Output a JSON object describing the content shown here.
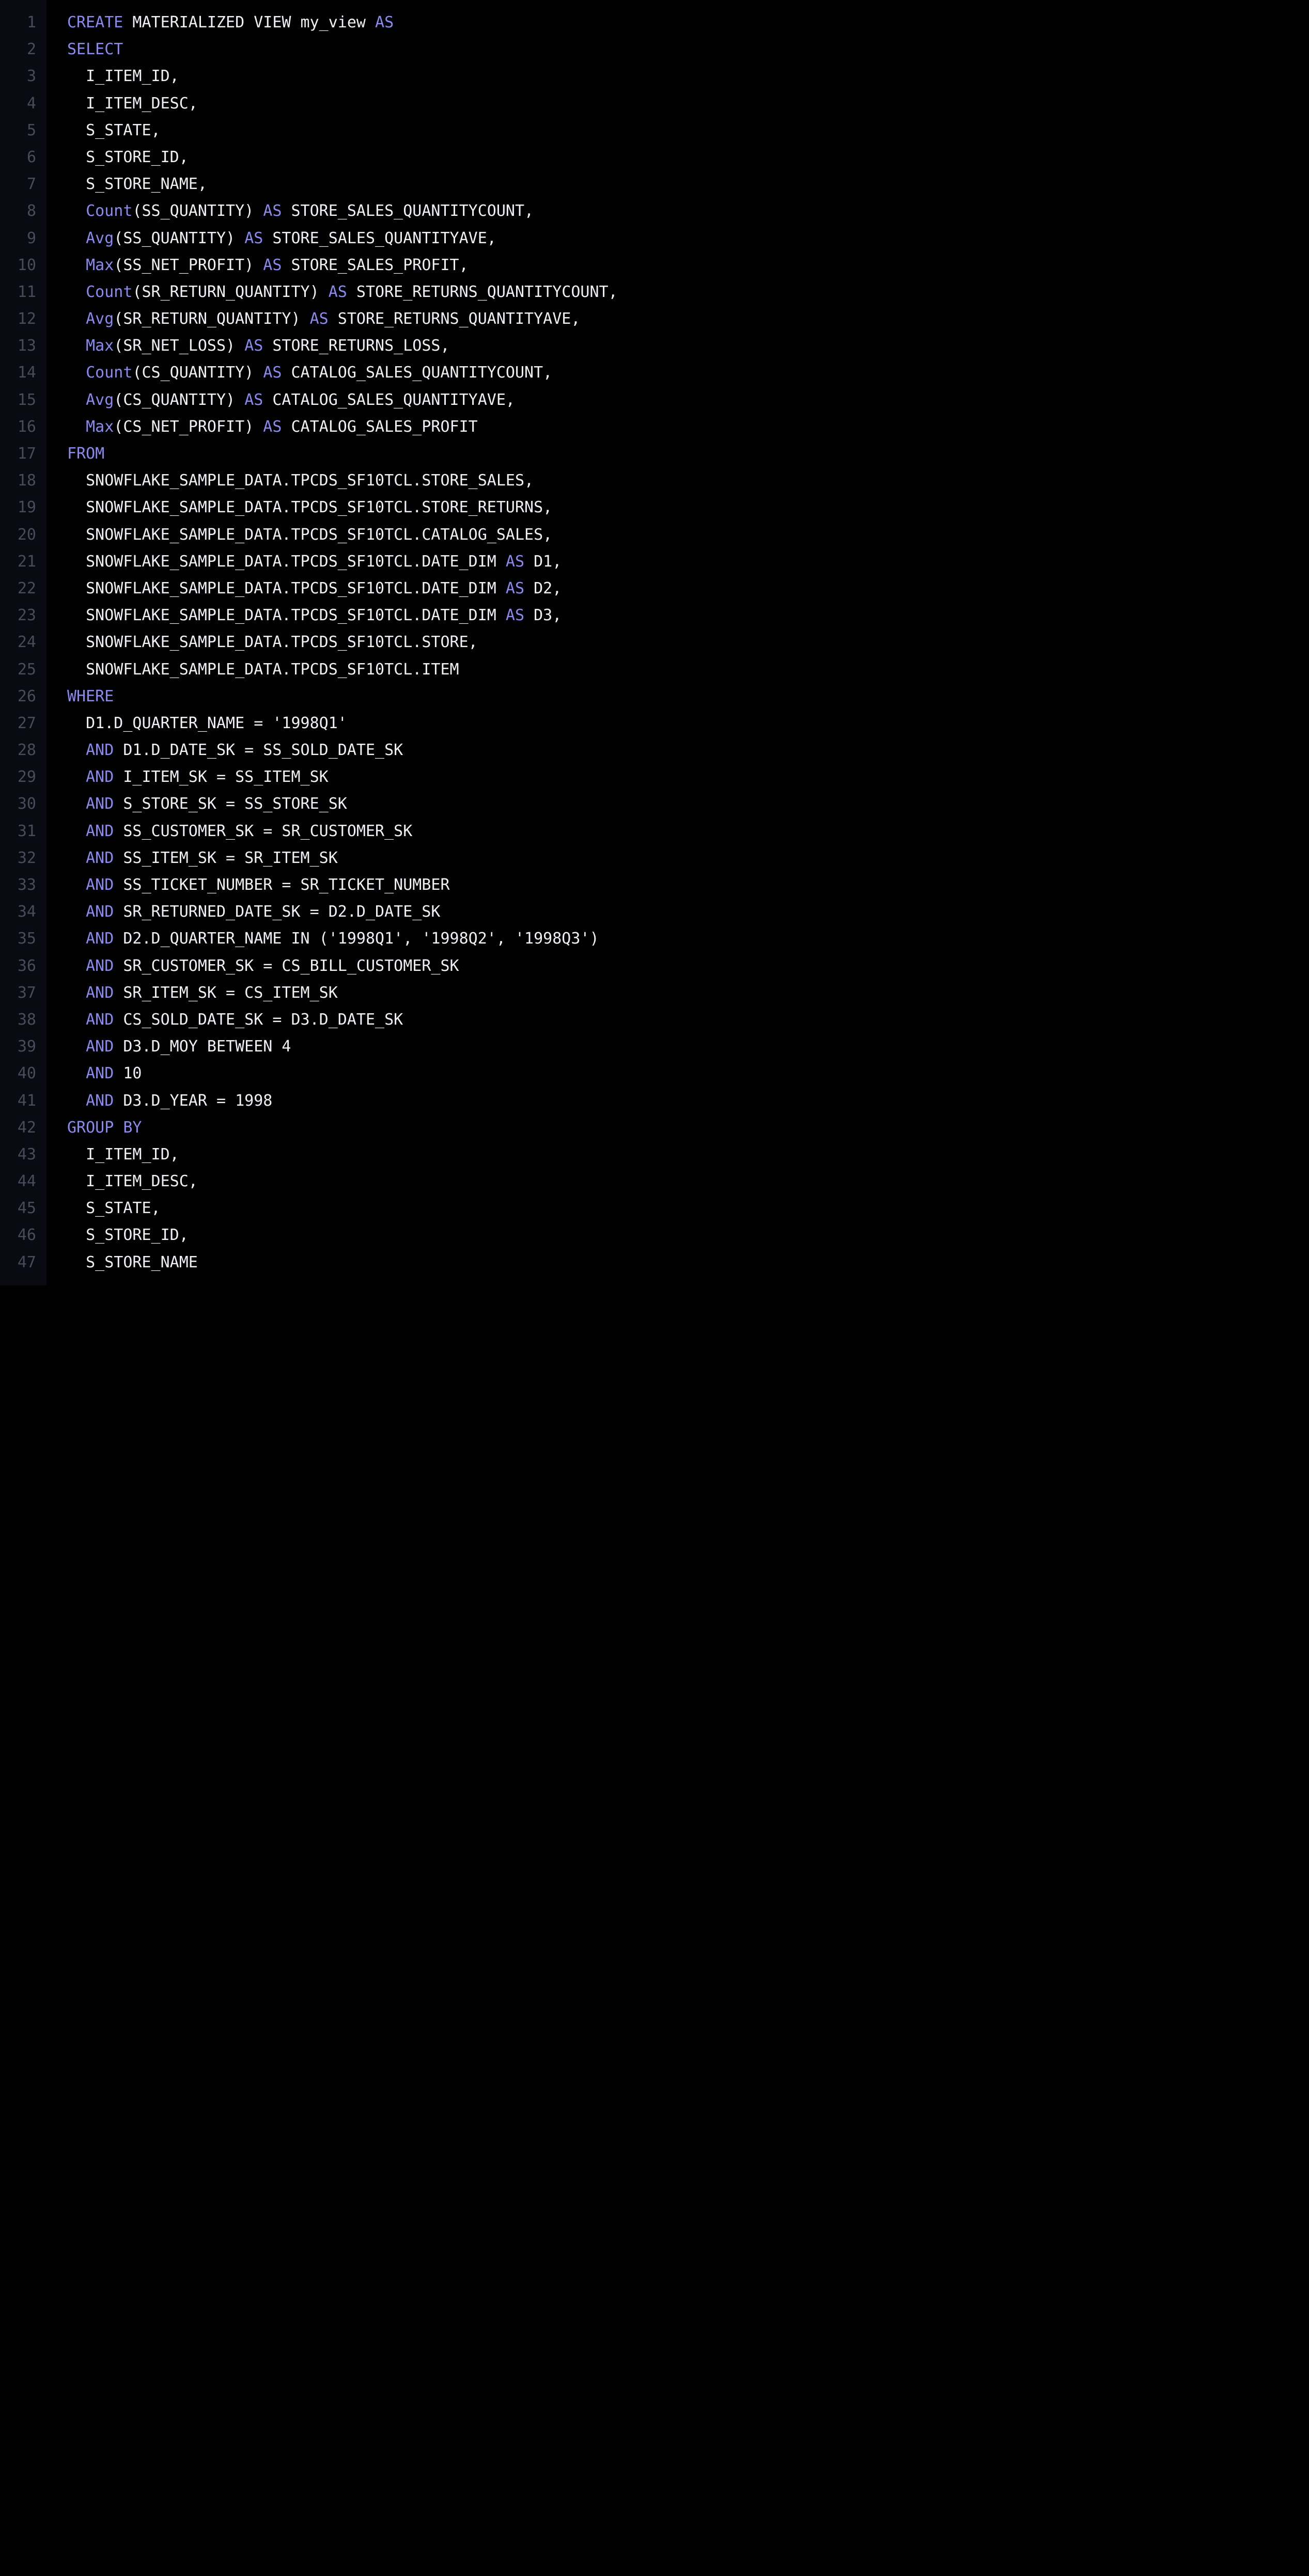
{
  "lines": [
    {
      "n": "1",
      "tokens": [
        {
          "t": "CREATE",
          "c": "kw"
        },
        {
          "t": " MATERIALIZED VIEW my_view ",
          "c": "txt"
        },
        {
          "t": "AS",
          "c": "kw"
        }
      ]
    },
    {
      "n": "2",
      "tokens": [
        {
          "t": "SELECT",
          "c": "kw"
        }
      ]
    },
    {
      "n": "3",
      "tokens": [
        {
          "t": "  I_ITEM_ID,",
          "c": "txt"
        }
      ]
    },
    {
      "n": "4",
      "tokens": [
        {
          "t": "  I_ITEM_DESC,",
          "c": "txt"
        }
      ]
    },
    {
      "n": "5",
      "tokens": [
        {
          "t": "  S_STATE,",
          "c": "txt"
        }
      ]
    },
    {
      "n": "6",
      "tokens": [
        {
          "t": "  S_STORE_ID,",
          "c": "txt"
        }
      ]
    },
    {
      "n": "7",
      "tokens": [
        {
          "t": "  S_STORE_NAME,",
          "c": "txt"
        }
      ]
    },
    {
      "n": "8",
      "tokens": [
        {
          "t": "  ",
          "c": "txt"
        },
        {
          "t": "Count",
          "c": "fn"
        },
        {
          "t": "(SS_QUANTITY) ",
          "c": "txt"
        },
        {
          "t": "AS",
          "c": "kw"
        },
        {
          "t": " STORE_SALES_QUANTITYCOUNT,",
          "c": "txt"
        }
      ]
    },
    {
      "n": "9",
      "tokens": [
        {
          "t": "  ",
          "c": "txt"
        },
        {
          "t": "Avg",
          "c": "fn"
        },
        {
          "t": "(SS_QUANTITY) ",
          "c": "txt"
        },
        {
          "t": "AS",
          "c": "kw"
        },
        {
          "t": " STORE_SALES_QUANTITYAVE,",
          "c": "txt"
        }
      ]
    },
    {
      "n": "10",
      "tokens": [
        {
          "t": "  ",
          "c": "txt"
        },
        {
          "t": "Max",
          "c": "fn"
        },
        {
          "t": "(SS_NET_PROFIT) ",
          "c": "txt"
        },
        {
          "t": "AS",
          "c": "kw"
        },
        {
          "t": " STORE_SALES_PROFIT,",
          "c": "txt"
        }
      ]
    },
    {
      "n": "11",
      "tokens": [
        {
          "t": "  ",
          "c": "txt"
        },
        {
          "t": "Count",
          "c": "fn"
        },
        {
          "t": "(SR_RETURN_QUANTITY) ",
          "c": "txt"
        },
        {
          "t": "AS",
          "c": "kw"
        },
        {
          "t": " STORE_RETURNS_QUANTITYCOUNT,",
          "c": "txt"
        }
      ]
    },
    {
      "n": "12",
      "tokens": [
        {
          "t": "  ",
          "c": "txt"
        },
        {
          "t": "Avg",
          "c": "fn"
        },
        {
          "t": "(SR_RETURN_QUANTITY) ",
          "c": "txt"
        },
        {
          "t": "AS",
          "c": "kw"
        },
        {
          "t": " STORE_RETURNS_QUANTITYAVE,",
          "c": "txt"
        }
      ]
    },
    {
      "n": "13",
      "tokens": [
        {
          "t": "  ",
          "c": "txt"
        },
        {
          "t": "Max",
          "c": "fn"
        },
        {
          "t": "(SR_NET_LOSS) ",
          "c": "txt"
        },
        {
          "t": "AS",
          "c": "kw"
        },
        {
          "t": " STORE_RETURNS_LOSS,",
          "c": "txt"
        }
      ]
    },
    {
      "n": "14",
      "tokens": [
        {
          "t": "  ",
          "c": "txt"
        },
        {
          "t": "Count",
          "c": "fn"
        },
        {
          "t": "(CS_QUANTITY) ",
          "c": "txt"
        },
        {
          "t": "AS",
          "c": "kw"
        },
        {
          "t": " CATALOG_SALES_QUANTITYCOUNT,",
          "c": "txt"
        }
      ]
    },
    {
      "n": "15",
      "tokens": [
        {
          "t": "  ",
          "c": "txt"
        },
        {
          "t": "Avg",
          "c": "fn"
        },
        {
          "t": "(CS_QUANTITY) ",
          "c": "txt"
        },
        {
          "t": "AS",
          "c": "kw"
        },
        {
          "t": " CATALOG_SALES_QUANTITYAVE,",
          "c": "txt"
        }
      ]
    },
    {
      "n": "16",
      "tokens": [
        {
          "t": "  ",
          "c": "txt"
        },
        {
          "t": "Max",
          "c": "fn"
        },
        {
          "t": "(CS_NET_PROFIT) ",
          "c": "txt"
        },
        {
          "t": "AS",
          "c": "kw"
        },
        {
          "t": " CATALOG_SALES_PROFIT",
          "c": "txt"
        }
      ]
    },
    {
      "n": "17",
      "tokens": [
        {
          "t": "FROM",
          "c": "kw"
        }
      ]
    },
    {
      "n": "18",
      "tokens": [
        {
          "t": "  SNOWFLAKE_SAMPLE_DATA.TPCDS_SF10TCL.STORE_SALES,",
          "c": "txt"
        }
      ]
    },
    {
      "n": "19",
      "tokens": [
        {
          "t": "  SNOWFLAKE_SAMPLE_DATA.TPCDS_SF10TCL.STORE_RETURNS,",
          "c": "txt"
        }
      ]
    },
    {
      "n": "20",
      "tokens": [
        {
          "t": "  SNOWFLAKE_SAMPLE_DATA.TPCDS_SF10TCL.CATALOG_SALES,",
          "c": "txt"
        }
      ]
    },
    {
      "n": "21",
      "tokens": [
        {
          "t": "  SNOWFLAKE_SAMPLE_DATA.TPCDS_SF10TCL.DATE_DIM ",
          "c": "txt"
        },
        {
          "t": "AS",
          "c": "kw"
        },
        {
          "t": " D1,",
          "c": "txt"
        }
      ]
    },
    {
      "n": "22",
      "tokens": [
        {
          "t": "  SNOWFLAKE_SAMPLE_DATA.TPCDS_SF10TCL.DATE_DIM ",
          "c": "txt"
        },
        {
          "t": "AS",
          "c": "kw"
        },
        {
          "t": " D2,",
          "c": "txt"
        }
      ]
    },
    {
      "n": "23",
      "tokens": [
        {
          "t": "  SNOWFLAKE_SAMPLE_DATA.TPCDS_SF10TCL.DATE_DIM ",
          "c": "txt"
        },
        {
          "t": "AS",
          "c": "kw"
        },
        {
          "t": " D3,",
          "c": "txt"
        }
      ]
    },
    {
      "n": "24",
      "tokens": [
        {
          "t": "  SNOWFLAKE_SAMPLE_DATA.TPCDS_SF10TCL.STORE,",
          "c": "txt"
        }
      ]
    },
    {
      "n": "25",
      "tokens": [
        {
          "t": "  SNOWFLAKE_SAMPLE_DATA.TPCDS_SF10TCL.ITEM",
          "c": "txt"
        }
      ]
    },
    {
      "n": "26",
      "tokens": [
        {
          "t": "WHERE",
          "c": "kw"
        }
      ]
    },
    {
      "n": "27",
      "tokens": [
        {
          "t": "  D1.D_QUARTER_NAME = '1998Q1'",
          "c": "txt"
        }
      ]
    },
    {
      "n": "28",
      "tokens": [
        {
          "t": "  ",
          "c": "txt"
        },
        {
          "t": "AND",
          "c": "kw"
        },
        {
          "t": " D1.D_DATE_SK = SS_SOLD_DATE_SK",
          "c": "txt"
        }
      ]
    },
    {
      "n": "29",
      "tokens": [
        {
          "t": "  ",
          "c": "txt"
        },
        {
          "t": "AND",
          "c": "kw"
        },
        {
          "t": " I_ITEM_SK = SS_ITEM_SK",
          "c": "txt"
        }
      ]
    },
    {
      "n": "30",
      "tokens": [
        {
          "t": "  ",
          "c": "txt"
        },
        {
          "t": "AND",
          "c": "kw"
        },
        {
          "t": " S_STORE_SK = SS_STORE_SK",
          "c": "txt"
        }
      ]
    },
    {
      "n": "31",
      "tokens": [
        {
          "t": "  ",
          "c": "txt"
        },
        {
          "t": "AND",
          "c": "kw"
        },
        {
          "t": " SS_CUSTOMER_SK = SR_CUSTOMER_SK",
          "c": "txt"
        }
      ]
    },
    {
      "n": "32",
      "tokens": [
        {
          "t": "  ",
          "c": "txt"
        },
        {
          "t": "AND",
          "c": "kw"
        },
        {
          "t": " SS_ITEM_SK = SR_ITEM_SK",
          "c": "txt"
        }
      ]
    },
    {
      "n": "33",
      "tokens": [
        {
          "t": "  ",
          "c": "txt"
        },
        {
          "t": "AND",
          "c": "kw"
        },
        {
          "t": " SS_TICKET_NUMBER = SR_TICKET_NUMBER",
          "c": "txt"
        }
      ]
    },
    {
      "n": "34",
      "tokens": [
        {
          "t": "  ",
          "c": "txt"
        },
        {
          "t": "AND",
          "c": "kw"
        },
        {
          "t": " SR_RETURNED_DATE_SK = D2.D_DATE_SK",
          "c": "txt"
        }
      ]
    },
    {
      "n": "35",
      "tokens": [
        {
          "t": "  ",
          "c": "txt"
        },
        {
          "t": "AND",
          "c": "kw"
        },
        {
          "t": " D2.D_QUARTER_NAME IN ('1998Q1', '1998Q2', '1998Q3')",
          "c": "txt"
        }
      ]
    },
    {
      "n": "36",
      "tokens": [
        {
          "t": "  ",
          "c": "txt"
        },
        {
          "t": "AND",
          "c": "kw"
        },
        {
          "t": " SR_CUSTOMER_SK = CS_BILL_CUSTOMER_SK",
          "c": "txt"
        }
      ]
    },
    {
      "n": "37",
      "tokens": [
        {
          "t": "  ",
          "c": "txt"
        },
        {
          "t": "AND",
          "c": "kw"
        },
        {
          "t": " SR_ITEM_SK = CS_ITEM_SK",
          "c": "txt"
        }
      ]
    },
    {
      "n": "38",
      "tokens": [
        {
          "t": "  ",
          "c": "txt"
        },
        {
          "t": "AND",
          "c": "kw"
        },
        {
          "t": " CS_SOLD_DATE_SK = D3.D_DATE_SK",
          "c": "txt"
        }
      ]
    },
    {
      "n": "39",
      "tokens": [
        {
          "t": "  ",
          "c": "txt"
        },
        {
          "t": "AND",
          "c": "kw"
        },
        {
          "t": " D3.D_MOY BETWEEN 4",
          "c": "txt"
        }
      ]
    },
    {
      "n": "40",
      "tokens": [
        {
          "t": "  ",
          "c": "txt"
        },
        {
          "t": "AND",
          "c": "kw"
        },
        {
          "t": " 10",
          "c": "txt"
        }
      ]
    },
    {
      "n": "41",
      "tokens": [
        {
          "t": "  ",
          "c": "txt"
        },
        {
          "t": "AND",
          "c": "kw"
        },
        {
          "t": " D3.D_YEAR = 1998",
          "c": "txt"
        }
      ]
    },
    {
      "n": "42",
      "tokens": [
        {
          "t": "GROUP BY",
          "c": "kw"
        }
      ]
    },
    {
      "n": "43",
      "tokens": [
        {
          "t": "  I_ITEM_ID,",
          "c": "txt"
        }
      ]
    },
    {
      "n": "44",
      "tokens": [
        {
          "t": "  I_ITEM_DESC,",
          "c": "txt"
        }
      ]
    },
    {
      "n": "45",
      "tokens": [
        {
          "t": "  S_STATE,",
          "c": "txt"
        }
      ]
    },
    {
      "n": "46",
      "tokens": [
        {
          "t": "  S_STORE_ID,",
          "c": "txt"
        }
      ]
    },
    {
      "n": "47",
      "tokens": [
        {
          "t": "  S_STORE_NAME",
          "c": "txt"
        }
      ]
    }
  ]
}
